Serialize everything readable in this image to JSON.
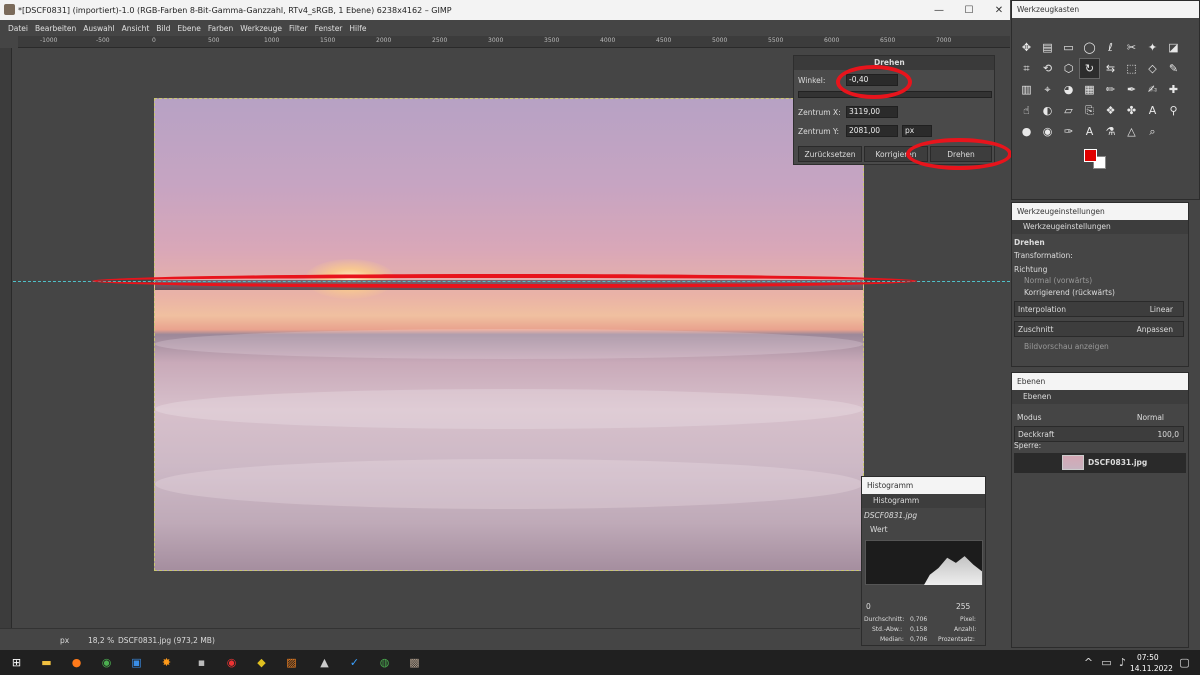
{
  "window": {
    "title": "*[DSCF0831] (importiert)-1.0 (RGB-Farben 8-Bit-Gamma-Ganzzahl, RTv4_sRGB, 1 Ebene) 6238x4162 – GIMP",
    "minimize": "—",
    "maximize": "☐",
    "close": "✕"
  },
  "menu": [
    "Datei",
    "Bearbeiten",
    "Auswahl",
    "Ansicht",
    "Bild",
    "Ebene",
    "Farben",
    "Werkzeuge",
    "Filter",
    "Fenster",
    "Hilfe"
  ],
  "ruler": {
    "h_ticks": [
      "-1000",
      "-500",
      "0",
      "500",
      "1000",
      "1500",
      "2000",
      "2500",
      "3000",
      "3500",
      "4000",
      "4500",
      "5000",
      "5500",
      "6000",
      "6500",
      "7000"
    ]
  },
  "rotate_dialog": {
    "title": "Drehen",
    "angle_label": "Winkel:",
    "angle_value": "-0,40",
    "center_x_label": "Zentrum X:",
    "center_x_value": "3119,00",
    "center_y_label": "Zentrum Y:",
    "center_y_value": "2081,00",
    "unit": "px",
    "reset_label": "Zurücksetzen",
    "correct_label": "Korrigieren",
    "rotate_label": "Drehen"
  },
  "statusbar": {
    "unit": "px",
    "zoom": "18,2 %",
    "file_info": "DSCF0831.jpg (973,2 MB)"
  },
  "toolbox": {
    "title": "Werkzeugkasten",
    "fg_color": "#e00000",
    "bg_color": "#ffffff"
  },
  "tool_options": {
    "title": "Werkzeugeinstellungen",
    "tab": "Werkzeugeinstellungen",
    "tool_name": "Drehen",
    "transformation_label": "Transformation:",
    "direction_label": "Richtung",
    "dir_normal": "Normal (vorwärts)",
    "dir_corrective": "Korrigierend (rückwärts)",
    "interpolation_label": "Interpolation",
    "interpolation_value": "Linear",
    "clipping_label": "Zuschnitt",
    "clipping_value": "Anpassen",
    "preview_label": "Bildvorschau anzeigen"
  },
  "layers": {
    "title": "Ebenen",
    "tab": "Ebenen",
    "mode_label": "Modus",
    "mode_value": "Normal",
    "opacity_label": "Deckkraft",
    "opacity_value": "100,0",
    "lock_label": "Sperre:",
    "layer_name": "DSCF0831.jpg"
  },
  "histogram": {
    "title": "Histogramm",
    "tab": "Histogramm",
    "file": "DSCF0831.jpg",
    "channel": "Wert",
    "range_min": "0",
    "range_max": "255",
    "mean_label": "Durchschnitt:",
    "mean_value": "0,706",
    "std_label": "Std.-Abw.:",
    "std_value": "0,158",
    "median_label": "Median:",
    "median_value": "0,706",
    "pixels_label": "Pixel:",
    "count_label": "Anzahl:",
    "percent_label": "Prozentsatz:"
  },
  "taskbar": {
    "time": "07:50",
    "date": "14.11.2022"
  }
}
